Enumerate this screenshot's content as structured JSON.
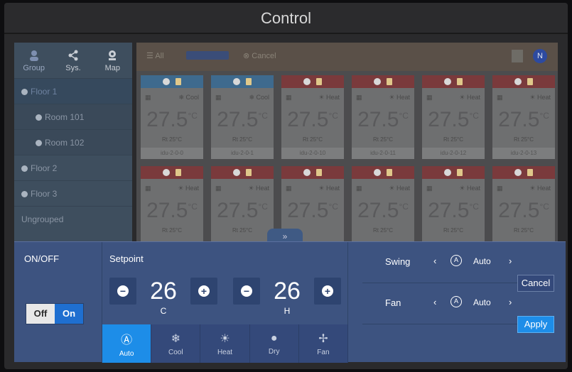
{
  "window": {
    "title": "Control"
  },
  "sidebar": {
    "tabs": [
      {
        "label": "Group",
        "icon": "group-icon"
      },
      {
        "label": "Sys.",
        "icon": "share-icon"
      },
      {
        "label": "Map",
        "icon": "map-pin-icon"
      }
    ],
    "items": [
      {
        "label": "Floor 1"
      },
      {
        "label": "Room 101"
      },
      {
        "label": "Room 102"
      },
      {
        "label": "Floor 2"
      },
      {
        "label": "Floor 3"
      },
      {
        "label": "Ungrouped"
      }
    ]
  },
  "toolbar": {
    "all_label": "All",
    "cancel_label": "Cancel",
    "user_initial": "N"
  },
  "cards": [
    {
      "mode": "Cool",
      "temp": "27.5",
      "unit": "°C",
      "rt": "Rt 25°C",
      "name": "idu-2-0-0"
    },
    {
      "mode": "Cool",
      "temp": "27.5",
      "unit": "°C",
      "rt": "Rt 25°C",
      "name": "idu-2-0-1"
    },
    {
      "mode": "Heat",
      "temp": "27.5",
      "unit": "°C",
      "rt": "Rt 25°C",
      "name": "idu-2-0-10"
    },
    {
      "mode": "Heat",
      "temp": "27.5",
      "unit": "°C",
      "rt": "Rt 25°C",
      "name": "idu-2-0-11"
    },
    {
      "mode": "Heat",
      "temp": "27.5",
      "unit": "°C",
      "rt": "Rt 25°C",
      "name": "idu-2-0-12"
    },
    {
      "mode": "Heat",
      "temp": "27.5",
      "unit": "°C",
      "rt": "Rt 25°C",
      "name": "idu-2-0-13"
    },
    {
      "mode": "Heat",
      "temp": "27.5",
      "unit": "°C",
      "rt": "Rt 25°C",
      "name": ""
    },
    {
      "mode": "Heat",
      "temp": "27.5",
      "unit": "°C",
      "rt": "Rt 25°C",
      "name": ""
    },
    {
      "mode": "Heat",
      "temp": "27.5",
      "unit": "°C",
      "rt": "",
      "name": ""
    },
    {
      "mode": "Heat",
      "temp": "27.5",
      "unit": "°C",
      "rt": "Rt 25°C",
      "name": ""
    },
    {
      "mode": "Heat",
      "temp": "27.5",
      "unit": "°C",
      "rt": "Rt 25°C",
      "name": ""
    },
    {
      "mode": "Heat",
      "temp": "27.5",
      "unit": "°C",
      "rt": "Rt 25°C",
      "name": ""
    }
  ],
  "panel": {
    "onoff_title": "ON/OFF",
    "off_label": "Off",
    "on_label": "On",
    "setpoint_title": "Setpoint",
    "cool_setpoint": "26",
    "cool_unit": "C",
    "heat_setpoint": "26",
    "heat_unit": "H",
    "modes": [
      {
        "label": "Auto",
        "icon": "auto-icon"
      },
      {
        "label": "Cool",
        "icon": "snowflake-icon"
      },
      {
        "label": "Heat",
        "icon": "sun-icon"
      },
      {
        "label": "Dry",
        "icon": "droplet-icon"
      },
      {
        "label": "Fan",
        "icon": "fan-icon"
      }
    ],
    "swing_label": "Swing",
    "swing_value": "Auto",
    "fan_label": "Fan",
    "fan_value": "Auto",
    "auto_glyph": "A",
    "cancel_label": "Cancel",
    "apply_label": "Apply"
  },
  "colors": {
    "accent": "#1d8de8",
    "panel": "#3d5380",
    "heat_header": "#7a3a3c",
    "cool_header": "#3e6a8e"
  }
}
